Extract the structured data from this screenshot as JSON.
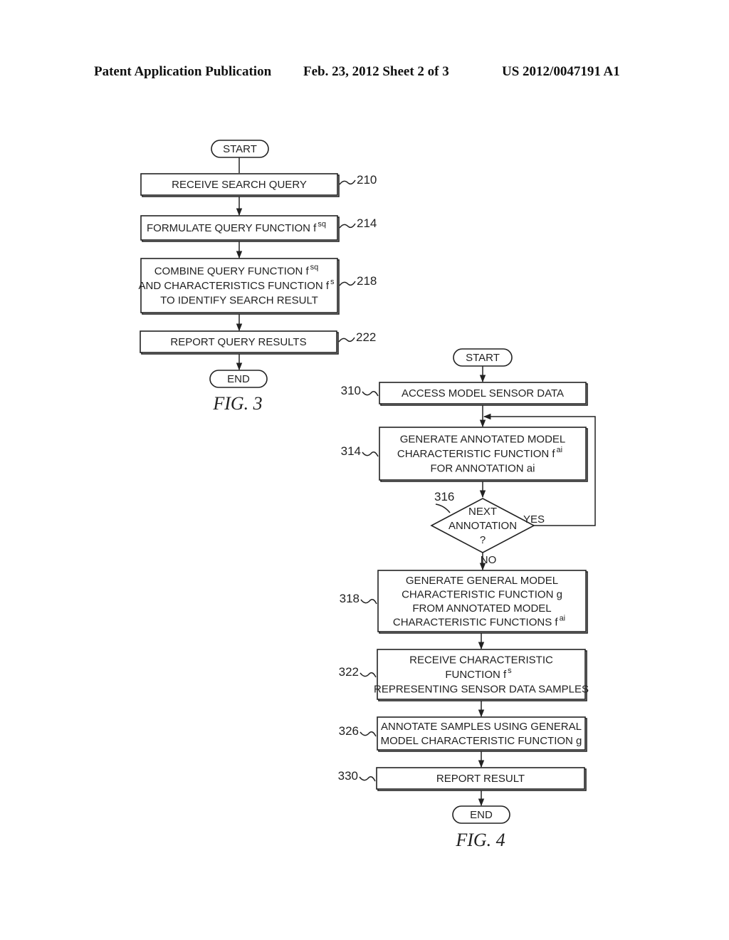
{
  "header": {
    "publication": "Patent Application Publication",
    "date_sheet": "Feb. 23, 2012   Sheet 2 of 3",
    "number": "US 2012/0047191 A1"
  },
  "fig3": {
    "caption": "FIG. 3",
    "start": "START",
    "end": "END",
    "steps": [
      {
        "ref": "210",
        "lines": [
          {
            "text": "RECEIVE SEARCH QUERY",
            "sup": ""
          }
        ]
      },
      {
        "ref": "214",
        "lines": [
          {
            "text": "FORMULATE QUERY FUNCTION f",
            "sup": "sq"
          }
        ]
      },
      {
        "ref": "218",
        "lines": [
          {
            "text": "COMBINE QUERY FUNCTION f",
            "sup": "sq"
          },
          {
            "text": "AND CHARACTERISTICS FUNCTION f",
            "sup": "s"
          },
          {
            "text": "TO IDENTIFY SEARCH RESULT",
            "sup": ""
          }
        ]
      },
      {
        "ref": "222",
        "lines": [
          {
            "text": "REPORT QUERY RESULTS",
            "sup": ""
          }
        ]
      }
    ]
  },
  "fig4": {
    "caption": "FIG. 4",
    "start": "START",
    "end": "END",
    "steps": [
      {
        "ref": "310",
        "lines": [
          {
            "text": "ACCESS MODEL SENSOR DATA",
            "sup": ""
          }
        ]
      },
      {
        "ref": "314",
        "lines": [
          {
            "text": "GENERATE ANNOTATED MODEL",
            "sup": ""
          },
          {
            "text": "CHARACTERISTIC FUNCTION f",
            "sup": "ai"
          },
          {
            "text": "FOR ANNOTATION ai",
            "sup": ""
          }
        ]
      },
      {
        "ref": "318",
        "lines": [
          {
            "text": "GENERATE GENERAL MODEL",
            "sup": ""
          },
          {
            "text": "CHARACTERISTIC FUNCTION g",
            "sup": ""
          },
          {
            "text": "FROM ANNOTATED MODEL",
            "sup": ""
          },
          {
            "text": "CHARACTERISTIC FUNCTIONS f",
            "sup": "ai"
          }
        ]
      },
      {
        "ref": "322",
        "lines": [
          {
            "text": "RECEIVE CHARACTERISTIC",
            "sup": ""
          },
          {
            "text": "FUNCTION f",
            "sup": "s"
          },
          {
            "text": "REPRESENTING SENSOR DATA SAMPLES",
            "sup": ""
          }
        ]
      },
      {
        "ref": "326",
        "lines": [
          {
            "text": "ANNOTATE SAMPLES USING GENERAL",
            "sup": ""
          },
          {
            "text": "MODEL CHARACTERISTIC FUNCTION g",
            "sup": ""
          }
        ]
      },
      {
        "ref": "330",
        "lines": [
          {
            "text": "REPORT RESULT",
            "sup": ""
          }
        ]
      }
    ],
    "decision": {
      "ref": "316",
      "lines": [
        "NEXT",
        "ANNOTATION",
        "?"
      ],
      "yes_label": "YES",
      "no_label": "NO"
    }
  }
}
